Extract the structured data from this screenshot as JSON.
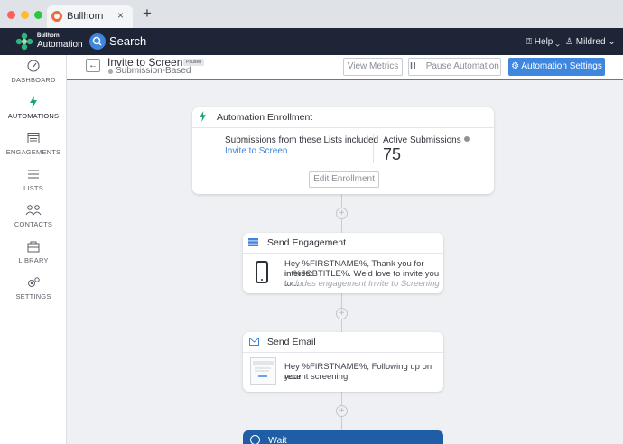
{
  "browser": {
    "tab_title": "Bullhorn",
    "tab_close": "×",
    "new_tab": "+"
  },
  "app": {
    "logo_line1": "Bullhorn",
    "logo_line2": "Automation",
    "search_label": "Search",
    "help_label": "Help",
    "user_label": "Mildred"
  },
  "sidebar": {
    "items": [
      {
        "label": "DASHBOARD",
        "icon": "gauge-icon"
      },
      {
        "label": "AUTOMATIONS",
        "icon": "bolt-icon",
        "active": true
      },
      {
        "label": "ENGAGEMENTS",
        "icon": "engagements-icon"
      },
      {
        "label": "LISTS",
        "icon": "list-icon"
      },
      {
        "label": "CONTACTS",
        "icon": "contacts-icon"
      },
      {
        "label": "LIBRARY",
        "icon": "library-icon"
      },
      {
        "label": "SETTINGS",
        "icon": "gear-icon"
      }
    ]
  },
  "header": {
    "back_label": "←",
    "title": "Invite to Screen",
    "status_badge": "Paused",
    "subtitle": "Submission-Based",
    "view_metrics": "View Metrics",
    "pause_icon": "II",
    "pause_automation": "Pause Automation",
    "settings_icon": "⚙",
    "automation_settings": "Automation Settings"
  },
  "enrollment": {
    "title": "Automation Enrollment",
    "lists_label": "Submissions from these Lists included",
    "list_link": "Invite to Screen",
    "active_label": "Active Submissions",
    "active_value": "75",
    "edit_button": "Edit Enrollment"
  },
  "steps": {
    "plus": "+",
    "engagement": {
      "title": "Send Engagement",
      "line1": "Hey %FIRSTNAME%, Thank you for interest",
      "line2": "in %JOBTITLE%. We'd love to invite you to...",
      "subline": "includes engagement Invite to Screening"
    },
    "email": {
      "title": "Send Email",
      "line1": "Hey %FIRSTNAME%, Following up on your",
      "line2": "recent screening"
    },
    "wait": {
      "title": "Wait"
    }
  },
  "colors": {
    "accent": "#3e86de",
    "appbar": "#1e2536",
    "green": "#19a37a",
    "wait_header": "#1f5ea6"
  }
}
